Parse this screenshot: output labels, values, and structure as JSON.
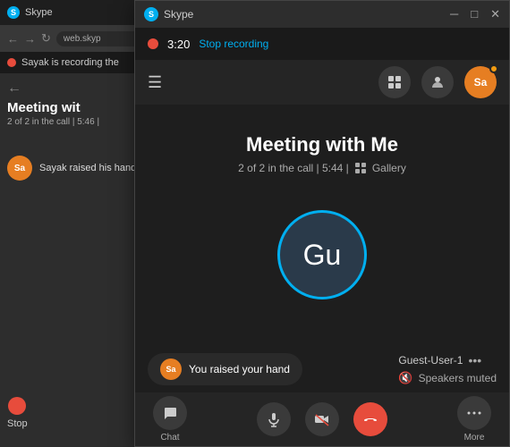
{
  "bgWindow": {
    "titlebar": {
      "icon": "S",
      "title": "Skype"
    },
    "addressbar": {
      "url": "web.skyp"
    },
    "recordingBar": {
      "text": "Sayak is recording the"
    },
    "meetingTitle": "Meeting wit",
    "meetingSubtitle": "2 of 2 in the call | 5:46 |",
    "notification": "Sayak raised his hand",
    "avatarInitials": "Sa",
    "stopLabel": "Stop"
  },
  "mainWindow": {
    "titlebar": {
      "icon": "S",
      "title": "Skype",
      "minimizeLabel": "─",
      "maximizeLabel": "□",
      "closeLabel": "✕"
    },
    "recordingBar": {
      "time": "3:20",
      "stopLabel": "Stop recording"
    },
    "toolbar": {
      "hamburgerIcon": "☰",
      "participantsIcon": "⊞",
      "peopleIcon": "👤",
      "avatarInitials": "Sa"
    },
    "callArea": {
      "meetingTitle": "Meeting with Me",
      "meta": "2 of 2 in the call | 5:44 |",
      "galleryLabel": "Gallery",
      "participantInitials": "Gu"
    },
    "notification": {
      "avatarInitials": "Sa",
      "handText": "You raised your hand",
      "guestName": "Guest-User-1",
      "speakersMuted": "Speakers muted"
    },
    "controls": {
      "chatLabel": "Chat",
      "muteLabel": "",
      "videoLabel": "",
      "endLabel": "",
      "moreLabel": "More"
    }
  }
}
